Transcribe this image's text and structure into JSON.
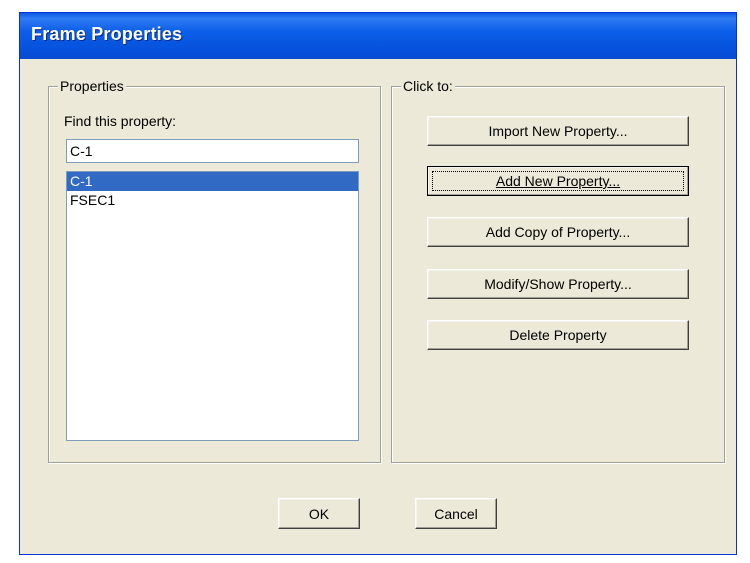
{
  "window": {
    "title": "Frame Properties"
  },
  "properties_group": {
    "legend": "Properties",
    "find_label": "Find this property:",
    "find_value": "C-1",
    "items": [
      {
        "label": "C-1",
        "selected": true
      },
      {
        "label": "FSEC1",
        "selected": false
      }
    ]
  },
  "click_group": {
    "legend": "Click to:",
    "buttons": [
      {
        "label": "Import New Property..."
      },
      {
        "label": "Add New Property..."
      },
      {
        "label": "Add Copy of Property..."
      },
      {
        "label": "Modify/Show Property..."
      },
      {
        "label": "Delete Property"
      }
    ]
  },
  "footer": {
    "ok_label": "OK",
    "cancel_label": "Cancel"
  },
  "colors": {
    "title_bar": "#0a5ae6",
    "selection": "#316ac5",
    "dialog_face": "#ece9d8"
  }
}
